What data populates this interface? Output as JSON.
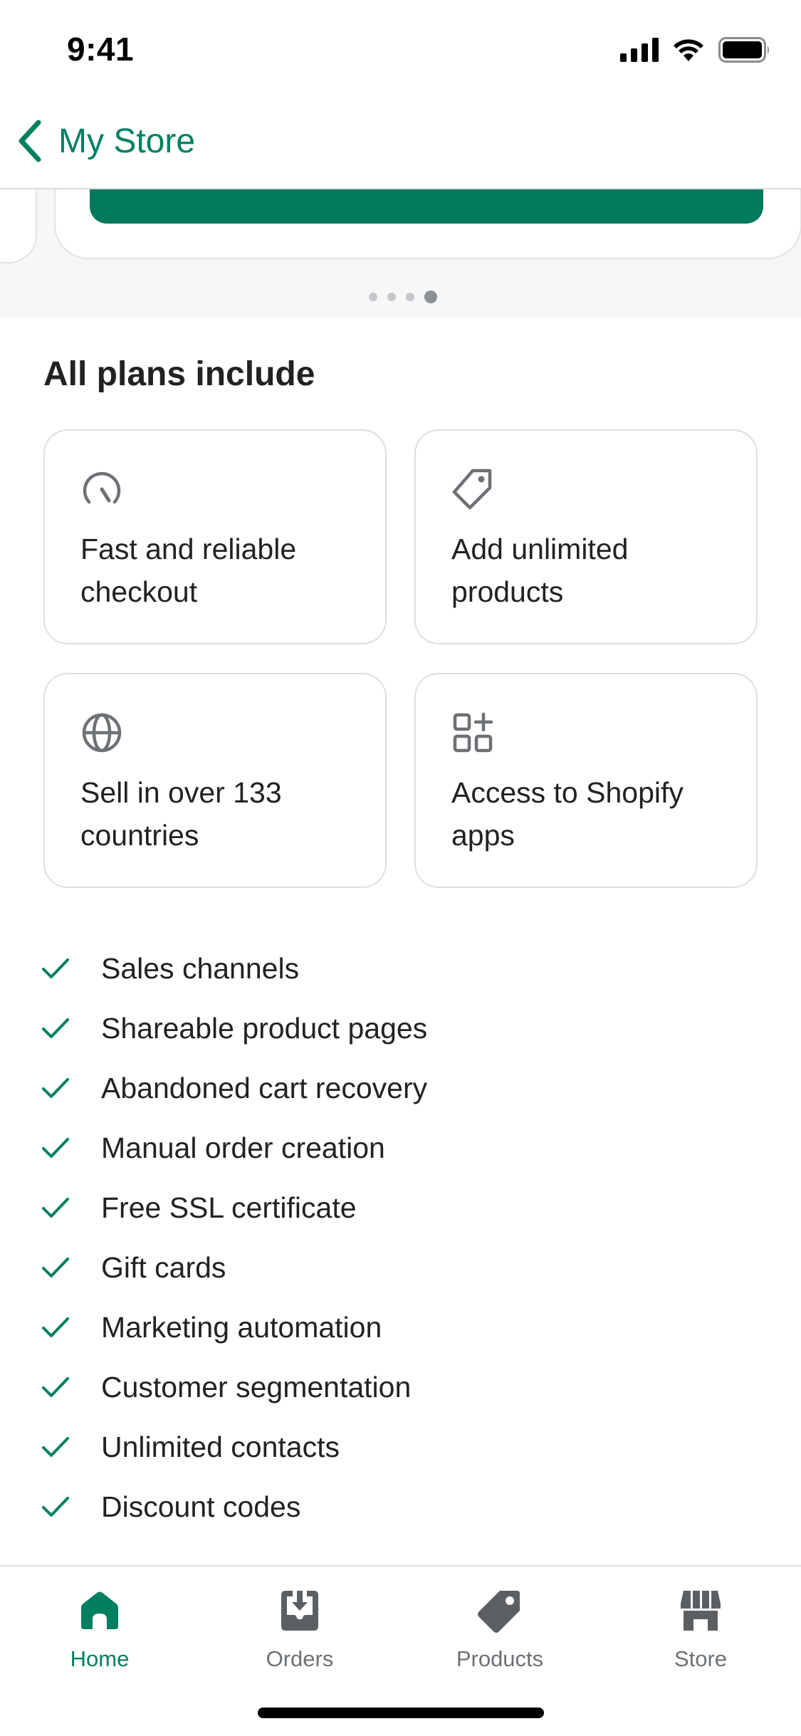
{
  "status_bar": {
    "time": "9:41"
  },
  "nav": {
    "back_label": "My Store",
    "back_icon": "chevron-left-icon"
  },
  "carousel": {
    "page_count": 4,
    "active_index": 3
  },
  "plans": {
    "title": "All plans include",
    "features": [
      {
        "icon": "speedometer-icon",
        "label": "Fast and reliable checkout"
      },
      {
        "icon": "tag-icon",
        "label": "Add unlimited products"
      },
      {
        "icon": "globe-icon",
        "label": "Sell in over 133 countries"
      },
      {
        "icon": "apps-icon",
        "label": "Access to Shopify apps"
      }
    ],
    "checklist": [
      "Sales channels",
      "Shareable product pages",
      "Abandoned cart recovery",
      "Manual order creation",
      "Free SSL certificate",
      "Gift cards",
      "Marketing automation",
      "Customer segmentation",
      "Unlimited contacts",
      "Discount codes"
    ]
  },
  "tab_bar": {
    "tabs": [
      {
        "label": "Home",
        "icon": "home-icon",
        "active": true
      },
      {
        "label": "Orders",
        "icon": "orders-icon",
        "active": false
      },
      {
        "label": "Products",
        "icon": "tag-icon",
        "active": false
      },
      {
        "label": "Store",
        "icon": "store-icon",
        "active": false
      }
    ]
  },
  "colors": {
    "accent": "#008060",
    "primary_button": "#007a5c",
    "text": "#202223",
    "muted_text": "#6d7175",
    "icon_gray": "#6d7175",
    "border": "#dcdfe2"
  }
}
